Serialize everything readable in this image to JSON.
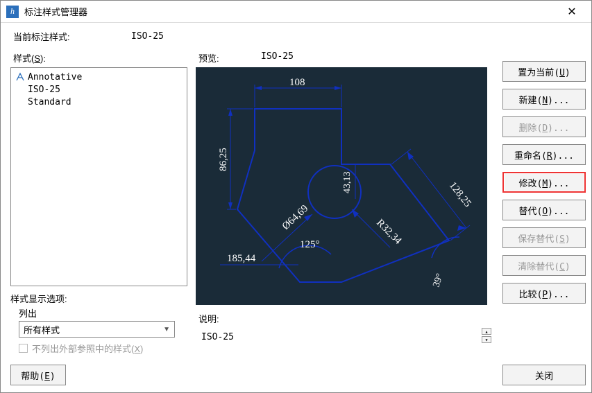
{
  "window": {
    "title": "标注样式管理器"
  },
  "current_style_label": "当前标注样式:",
  "current_style_value": "ISO-25",
  "styles_label": "样式(S):",
  "styles_list": {
    "items": [
      {
        "name": "Annotative",
        "icon": "annotative-icon"
      },
      {
        "name": "ISO-25",
        "child": true
      },
      {
        "name": "Standard",
        "child": true
      }
    ]
  },
  "preview_label": "预览:",
  "preview_style": "ISO-25",
  "preview_dims": {
    "top": "108",
    "left": "86,25",
    "diag": "Ø64,69",
    "angle": "125°",
    "bottom": "185,44",
    "radius": "R32,34",
    "vert_small": "43,13",
    "right": "128,25",
    "corner_angle": "39°"
  },
  "description_label": "说明:",
  "description_value": "ISO-25",
  "display_opts": {
    "header": "样式显示选项:",
    "list_out": "列出",
    "select_value": "所有样式",
    "checkbox_label": "不列出外部参照中的样式(X)"
  },
  "buttons": {
    "set_current": "置为当前(U)",
    "new": "新建(N)...",
    "delete": "删除(D)...",
    "rename": "重命名(R)...",
    "modify": "修改(M)...",
    "override": "替代(O)...",
    "save_override": "保存替代(S)",
    "clear_override": "清除替代(C)",
    "compare": "比较(P)...",
    "help": "帮助(E)",
    "close": "关闭"
  }
}
